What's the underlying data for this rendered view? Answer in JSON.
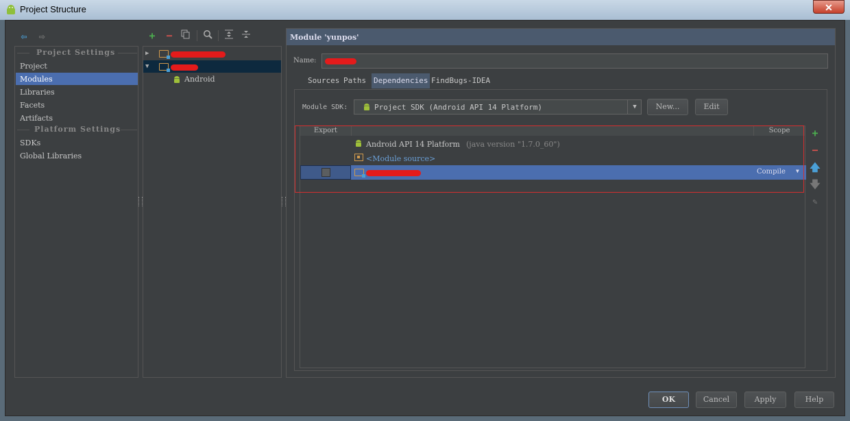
{
  "window": {
    "title": "Project Structure",
    "close_glyph": "✕"
  },
  "toolbar_icons": [
    "back-arrow-icon",
    "forward-arrow-icon",
    "add-icon",
    "remove-icon",
    "copy-icon",
    "search-icon",
    "expand-all-icon",
    "collapse-all-icon"
  ],
  "nav": {
    "project_settings_header": "Project Settings",
    "platform_settings_header": "Platform Settings",
    "project_items": [
      "Project",
      "Modules",
      "Libraries",
      "Facets",
      "Artifacts"
    ],
    "platform_items": [
      "SDKs",
      "Global Libraries"
    ],
    "selected": "Modules"
  },
  "tree": {
    "child_label": "Android"
  },
  "module": {
    "header": "Module 'yunpos'",
    "name_label": "Name:",
    "name_value": "",
    "tabs": [
      "Sources",
      "Paths",
      "Dependencies",
      "FindBugs-IDEA"
    ],
    "active_tab": "Dependencies",
    "sdk_label": "Module SDK:",
    "sdk_value": "Project SDK (Android API 14 Platform)",
    "new_button": "New...",
    "edit_button": "Edit"
  },
  "dependencies": {
    "col_export": "Export",
    "col_scope": "Scope",
    "rows": [
      {
        "name": "Android API 14 Platform",
        "detail": "(java version \"1.7.0_60\")"
      },
      {
        "name": "<Module source>",
        "detail": ""
      },
      {
        "name": "",
        "scope": "Compile"
      }
    ]
  },
  "footer": {
    "ok": "OK",
    "cancel": "Cancel",
    "apply": "Apply",
    "help": "Help"
  },
  "colors": {
    "selection": "#4b6eaf",
    "background": "#3c3f41",
    "highlight_box": "#d32f2f",
    "android_green": "#9fc03a"
  }
}
